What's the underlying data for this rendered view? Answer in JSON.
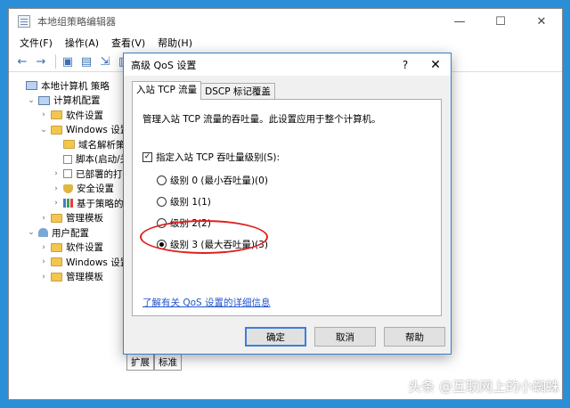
{
  "main_window": {
    "title": "本地组策略编辑器",
    "controls": {
      "minimize": "—",
      "maximize": "☐",
      "close": "✕"
    },
    "menu": [
      "文件(F)",
      "操作(A)",
      "查看(V)",
      "帮助(H)"
    ],
    "tree": [
      {
        "label": "本地计算机 策略",
        "toggle": "",
        "icon": "computer"
      },
      {
        "label": "计算机配置",
        "toggle": "⌄",
        "icon": "computer"
      },
      {
        "label": "软件设置",
        "toggle": "›",
        "icon": "folder"
      },
      {
        "label": "Windows 设置",
        "toggle": "⌄",
        "icon": "folder"
      },
      {
        "label": "域名解析策略",
        "toggle": "",
        "icon": "folder"
      },
      {
        "label": "脚本(启动/关",
        "toggle": "",
        "icon": "doc"
      },
      {
        "label": "已部署的打印",
        "toggle": "›",
        "icon": "doc"
      },
      {
        "label": "安全设置",
        "toggle": "›",
        "icon": "shield"
      },
      {
        "label": "基于策略的",
        "toggle": "›",
        "icon": "bars"
      },
      {
        "label": "管理模板",
        "toggle": "›",
        "icon": "folder"
      },
      {
        "label": "用户配置",
        "toggle": "⌄",
        "icon": "user"
      },
      {
        "label": "软件设置",
        "toggle": "›",
        "icon": "folder"
      },
      {
        "label": "Windows 设置",
        "toggle": "›",
        "icon": "folder"
      },
      {
        "label": "管理模板",
        "toggle": "›",
        "icon": "folder"
      }
    ],
    "status_tabs": [
      "扩展",
      "标准"
    ]
  },
  "dialog": {
    "title": "高级 QoS 设置",
    "help": "?",
    "close": "✕",
    "tabs": [
      "入站 TCP 流量",
      "DSCP 标记覆盖"
    ],
    "description": "管理入站 TCP 流量的吞吐量。此设置应用于整个计算机。",
    "checkbox_label": "指定入站 TCP 吞吐量级别(S):",
    "checkbox_checked": true,
    "radios": [
      {
        "label": "级别 0 (最小吞吐量)(0)",
        "selected": false
      },
      {
        "label": "级别 1(1)",
        "selected": false
      },
      {
        "label": "级别 2(2)",
        "selected": false
      },
      {
        "label": "级别 3 (最大吞吐量)(3)",
        "selected": true
      }
    ],
    "link": "了解有关 QoS 设置的详细信息",
    "buttons": {
      "ok": "确定",
      "cancel": "取消",
      "help": "帮助"
    }
  },
  "watermark": "头条 @互联网上的小蜘蛛",
  "colors": {
    "desktop": "#2a8fd6",
    "dialog_border": "#3a7fc9",
    "highlight_ellipse": "#e02020",
    "link": "#2255cc"
  }
}
